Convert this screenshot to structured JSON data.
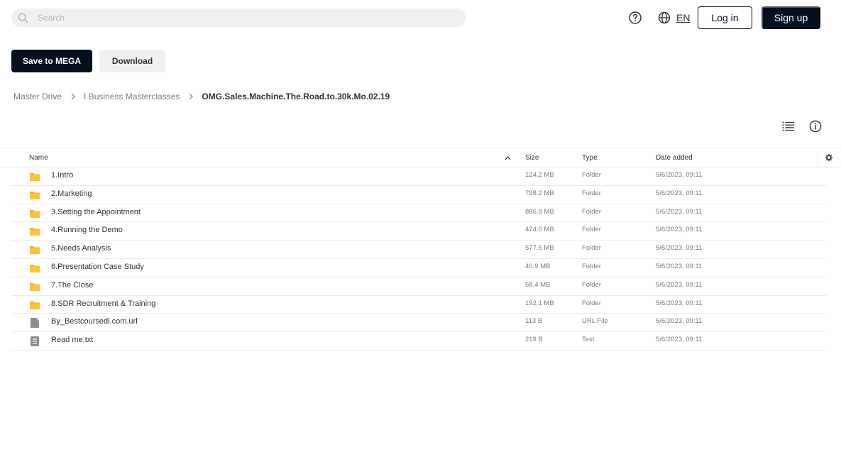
{
  "search": {
    "placeholder": "Search"
  },
  "header": {
    "language": "EN",
    "login_label": "Log in",
    "signup_label": "Sign up"
  },
  "actions": {
    "save_label": "Save to MEGA",
    "download_label": "Download"
  },
  "breadcrumb": {
    "items": [
      "Master Drive",
      "I Business Masterclasses"
    ],
    "current": "OMG.Sales.Machine.The.Road.to.30k.Mo.02.19"
  },
  "table": {
    "columns": {
      "name": "Name",
      "size": "Size",
      "type": "Type",
      "date": "Date added"
    },
    "rows": [
      {
        "icon": "folder-icon",
        "name": "1.Intro",
        "size": "124.2 MB",
        "type": "Folder",
        "date": "5/6/2023, 09:11"
      },
      {
        "icon": "folder-icon",
        "name": "2.Marketing",
        "size": "798.2 MB",
        "type": "Folder",
        "date": "5/6/2023, 09:11"
      },
      {
        "icon": "folder-icon",
        "name": "3.Setting the Appointment",
        "size": "886.9 MB",
        "type": "Folder",
        "date": "5/6/2023, 09:11"
      },
      {
        "icon": "folder-icon",
        "name": "4.Running the Demo",
        "size": "474.0 MB",
        "type": "Folder",
        "date": "5/6/2023, 09:11"
      },
      {
        "icon": "folder-icon",
        "name": "5.Needs Analysis",
        "size": "577.5 MB",
        "type": "Folder",
        "date": "5/6/2023, 09:11"
      },
      {
        "icon": "folder-icon",
        "name": "6.Presentation Case Study",
        "size": "40.9 MB",
        "type": "Folder",
        "date": "5/6/2023, 09:11"
      },
      {
        "icon": "folder-icon",
        "name": "7.The Close",
        "size": "58.4 MB",
        "type": "Folder",
        "date": "5/6/2023, 09:11"
      },
      {
        "icon": "folder-icon",
        "name": "8.SDR Recruitment & Training",
        "size": "192.1 MB",
        "type": "Folder",
        "date": "5/6/2023, 09:11"
      },
      {
        "icon": "url-file-icon",
        "name": "By_Bestcoursedl.com.url",
        "size": "113 B",
        "type": "URL File",
        "date": "5/6/2023, 09:11"
      },
      {
        "icon": "text-file-icon",
        "name": "Read me.txt",
        "size": "219 B",
        "type": "Text",
        "date": "5/6/2023, 09:11"
      }
    ]
  },
  "colors": {
    "primary_dark": "#04101e",
    "folder": "#f9b21d",
    "file_gray": "#8a8c8f",
    "border": "#ececec"
  }
}
